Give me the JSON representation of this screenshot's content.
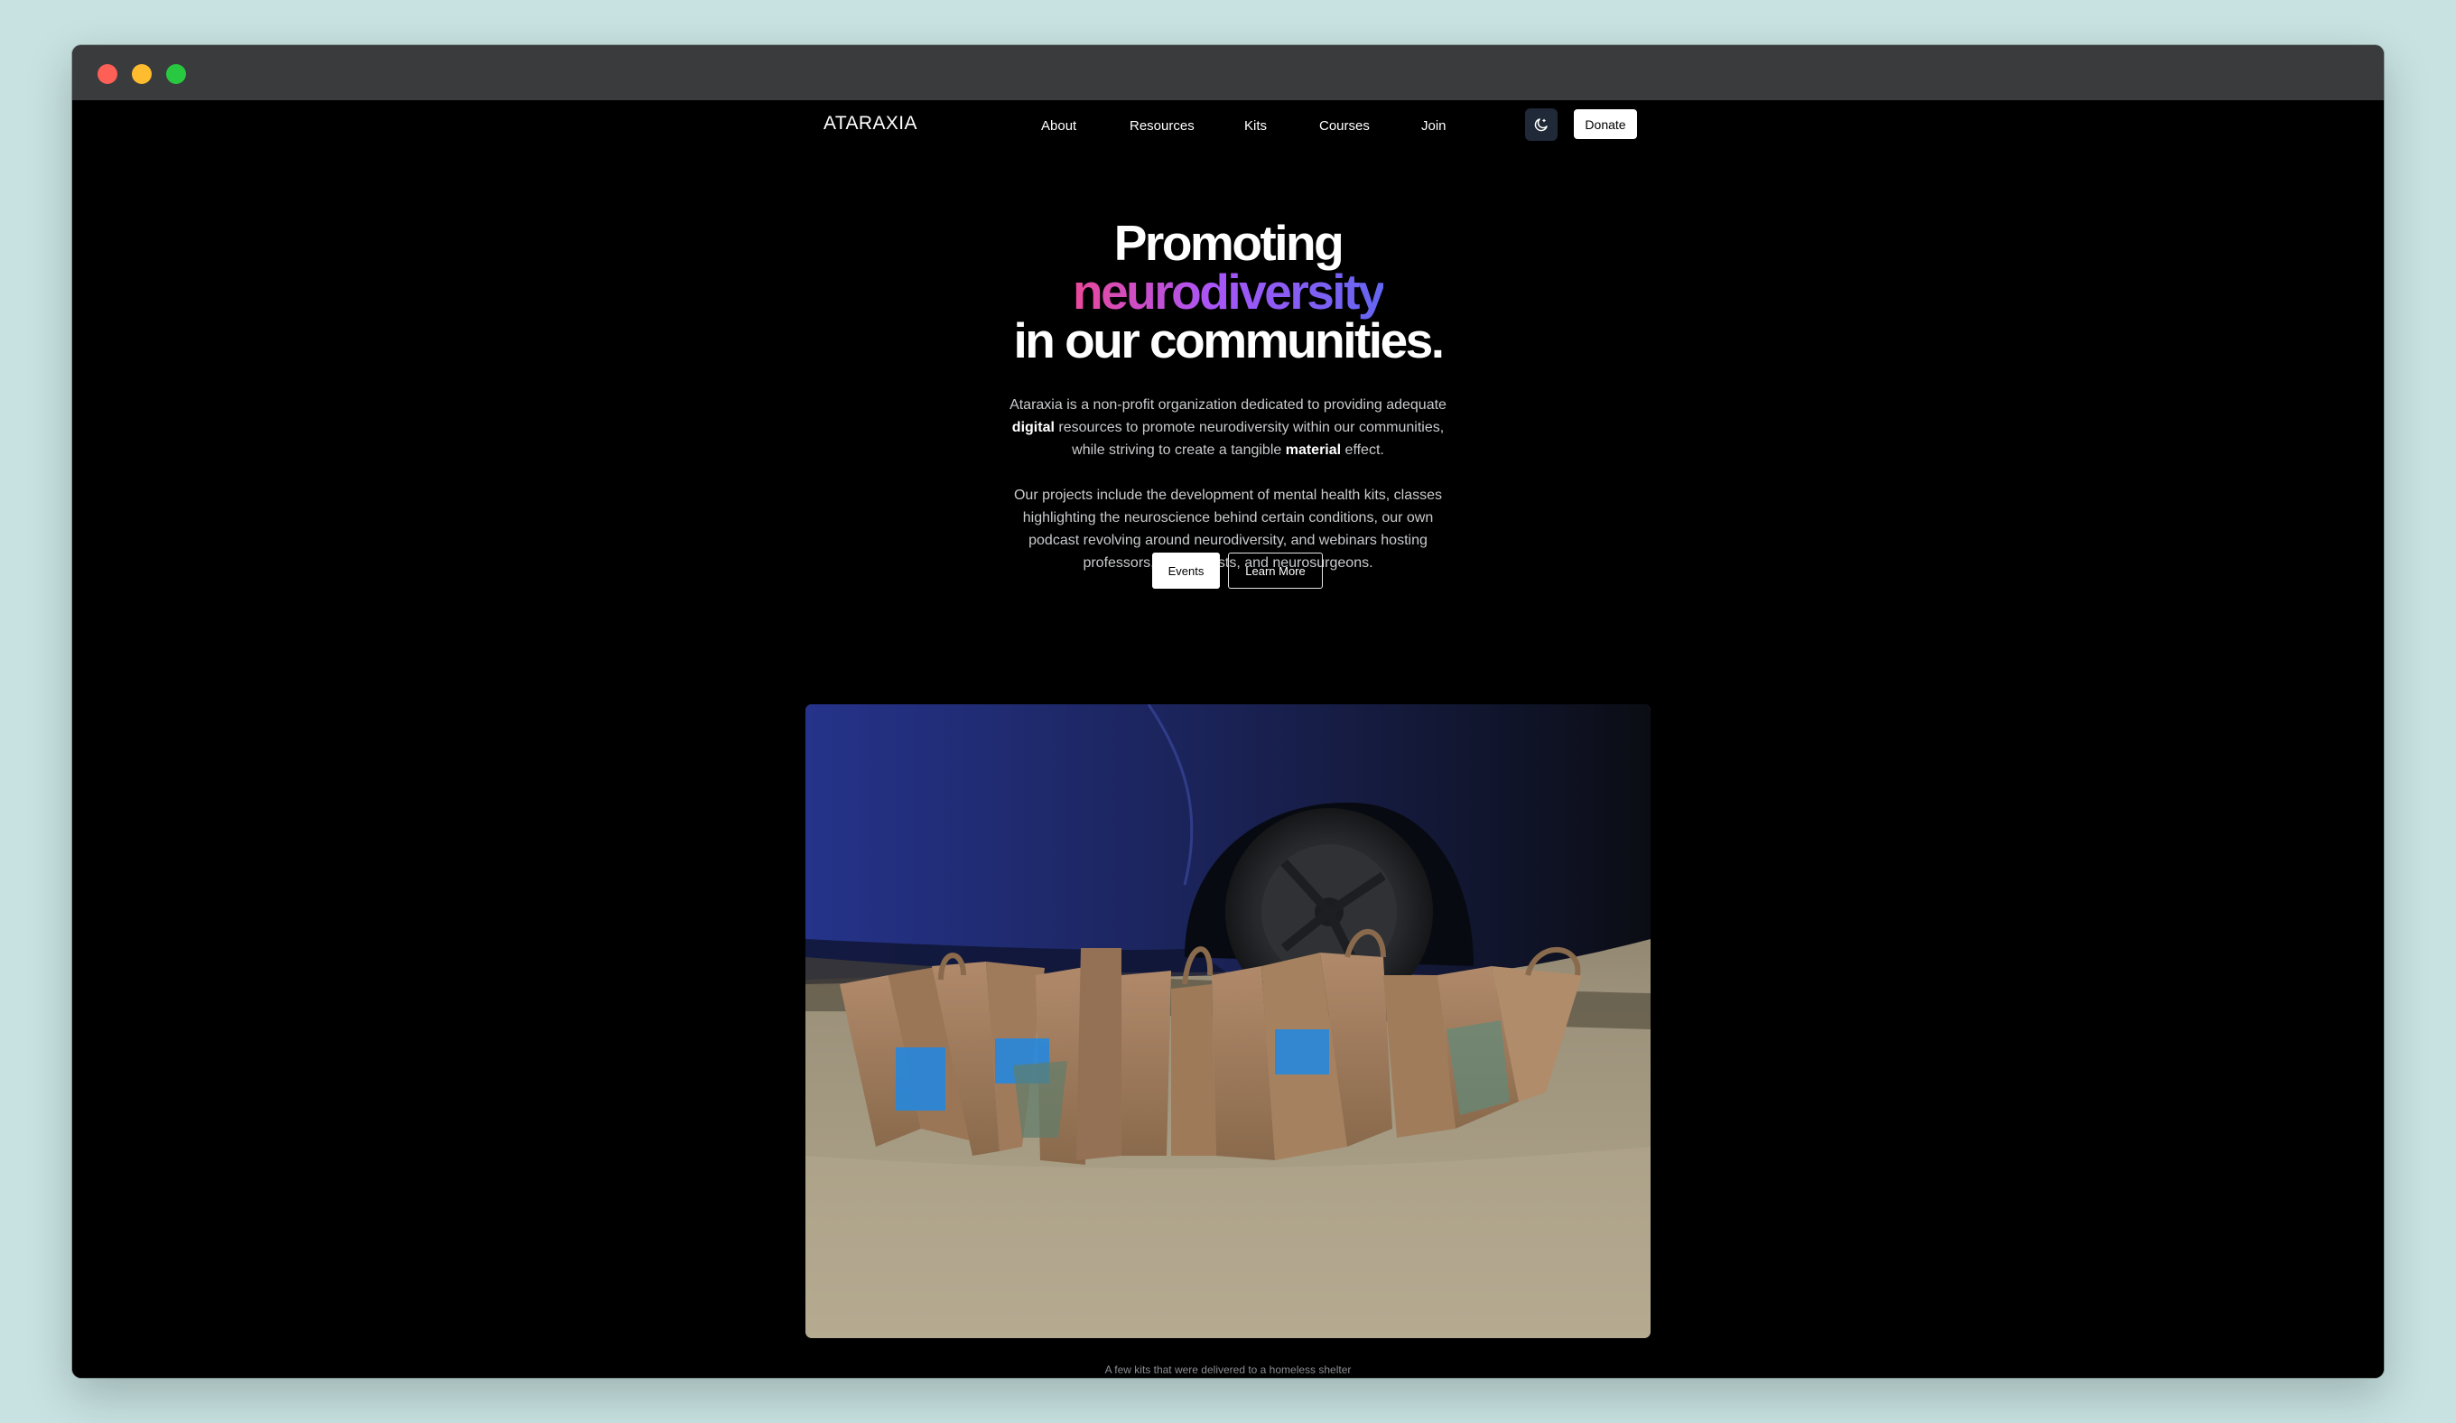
{
  "window": {
    "traffic_lights": [
      "close",
      "minimize",
      "zoom"
    ]
  },
  "nav": {
    "brand": "ATARAXIA",
    "links": [
      "About",
      "Resources",
      "Kits",
      "Courses",
      "Join"
    ],
    "theme_toggle_icon": "moon-icon",
    "donate_label": "Donate"
  },
  "hero": {
    "line1": "Promoting",
    "line2": "neurodiversity",
    "line3": "in our communities.",
    "gradient_colors": [
      "#ec4899",
      "#a855f7",
      "#6366f1"
    ]
  },
  "intro": {
    "p1_a": "Ataraxia is a non-profit organization dedicated to providing adequate",
    "p1_b_bold": "digital",
    "p1_c": "resources to promote neurodiversity within our communities,",
    "p1_d": "while striving to create a tangible",
    "p1_e_bold": "material",
    "p1_f": "effect.",
    "p2": "Our projects include the development of mental health kits, classes highlighting the neuroscience behind certain conditions, our own podcast revolving around neurodiversity, and webinars hosting professors, neurologists, and neurosurgeons."
  },
  "actions": {
    "events_label": "Events",
    "learn_more_label": "Learn More"
  },
  "photo": {
    "caption": "A few kits that were delivered to a homeless shelter"
  }
}
